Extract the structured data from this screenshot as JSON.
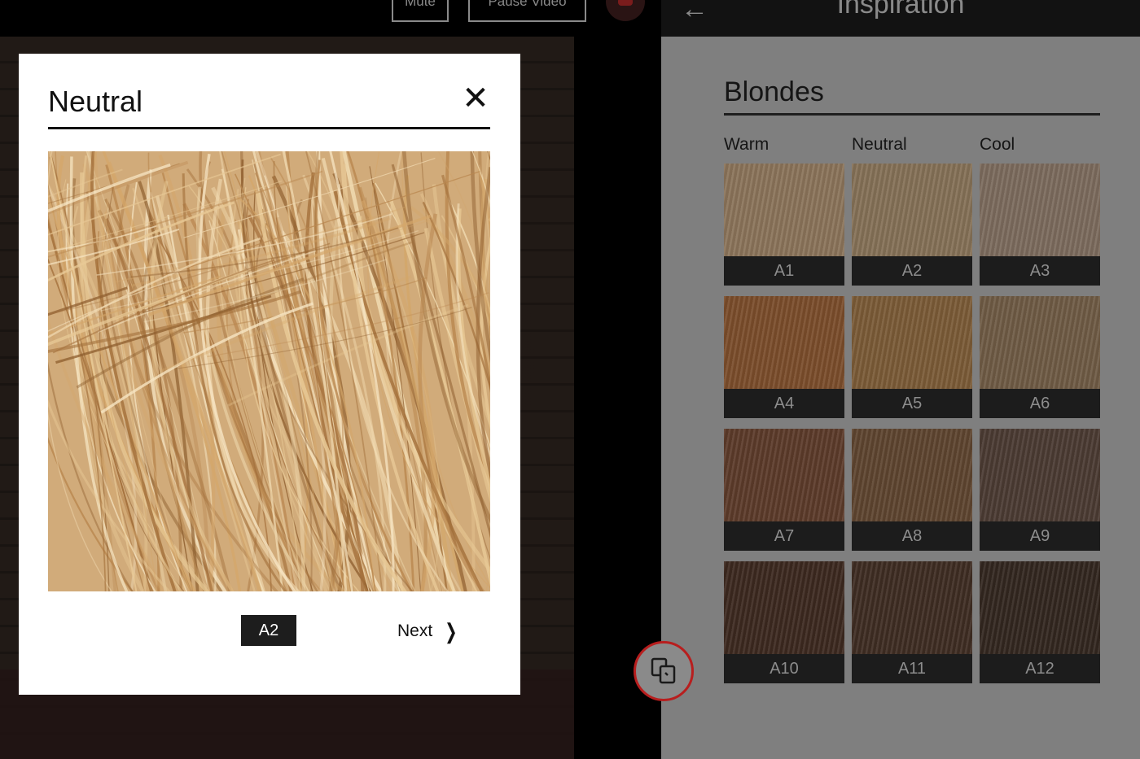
{
  "topbar": {
    "mute_label": "Mute",
    "pause_label": "Pause Video"
  },
  "inspiration": {
    "header_title": "Inspiration",
    "back_icon": "back-arrow-icon",
    "section_title": "Blondes",
    "columns": [
      "Warm",
      "Neutral",
      "Cool"
    ],
    "swatches": [
      {
        "label": "A1",
        "color": "#8a7359"
      },
      {
        "label": "A2",
        "color": "#847056"
      },
      {
        "label": "A3",
        "color": "#7b6a5c"
      },
      {
        "label": "A4",
        "color": "#7a4c2a"
      },
      {
        "label": "A5",
        "color": "#7a5a36"
      },
      {
        "label": "A6",
        "color": "#6e5a44"
      },
      {
        "label": "A7",
        "color": "#5b3a29"
      },
      {
        "label": "A8",
        "color": "#5d442f"
      },
      {
        "label": "A9",
        "color": "#4a3a32"
      },
      {
        "label": "A10",
        "color": "#3c281f"
      },
      {
        "label": "A11",
        "color": "#3e2c22"
      },
      {
        "label": "A12",
        "color": "#32261f"
      }
    ],
    "switch_icon": "compare-icon"
  },
  "modal": {
    "title": "Neutral",
    "close_icon": "close-icon",
    "selected_shade": "A2",
    "next_label": "Next",
    "next_icon": "chevron-right-icon"
  },
  "colors": {
    "accent": "#b81e1e",
    "panel_bg": "#7f7f7f",
    "label_bg": "#1c1c1c"
  }
}
